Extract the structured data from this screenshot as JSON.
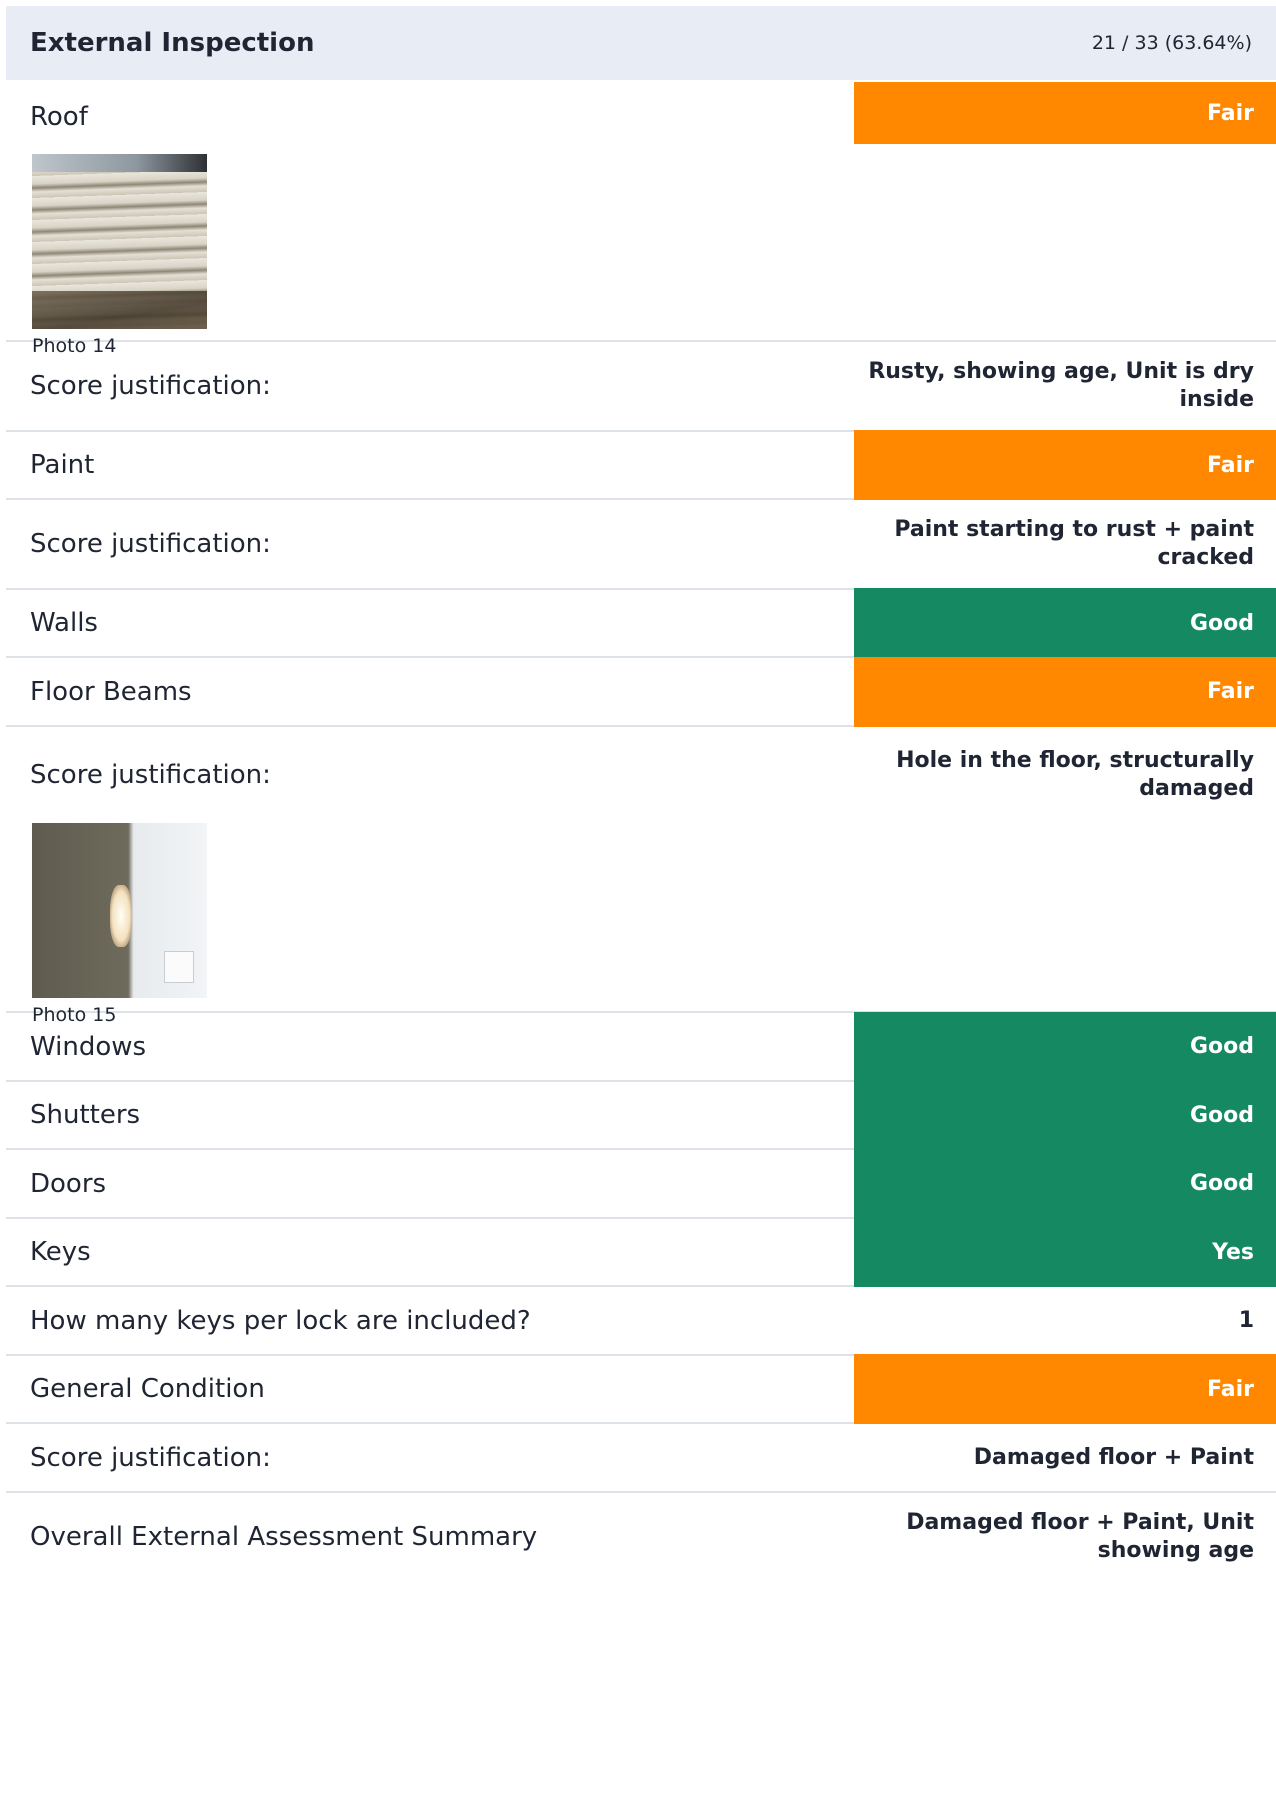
{
  "section": {
    "title": "External Inspection",
    "score": "21 / 33 (63.64%)"
  },
  "rows": {
    "roof": {
      "label": "Roof",
      "rating": "Fair",
      "photo_caption": "Photo 14"
    },
    "roof_just": {
      "label": "Score justification:",
      "value": "Rusty, showing age, Unit is dry inside"
    },
    "paint": {
      "label": "Paint",
      "rating": "Fair"
    },
    "paint_just": {
      "label": "Score justification:",
      "value": "Paint starting to rust + paint cracked"
    },
    "walls": {
      "label": "Walls",
      "rating": "Good"
    },
    "floor_beams": {
      "label": "Floor Beams",
      "rating": "Fair"
    },
    "floor_just": {
      "label": "Score justification:",
      "value": "Hole in the floor, structurally damaged",
      "photo_caption": "Photo 15"
    },
    "windows": {
      "label": "Windows",
      "rating": "Good"
    },
    "shutters": {
      "label": "Shutters",
      "rating": "Good"
    },
    "doors": {
      "label": "Doors",
      "rating": "Good"
    },
    "keys": {
      "label": "Keys",
      "rating": "Yes"
    },
    "keys_count": {
      "label": "How many keys per lock are included?",
      "value": "1"
    },
    "general": {
      "label": "General Condition",
      "rating": "Fair"
    },
    "general_just": {
      "label": "Score justification:",
      "value": "Damaged floor + Paint"
    },
    "summary": {
      "label": "Overall External Assessment Summary",
      "value": "Damaged floor + Paint, Unit showing age"
    }
  },
  "colors": {
    "fair": "#ff8800",
    "good": "#158a62",
    "header_bg": "#e8ecf4"
  }
}
